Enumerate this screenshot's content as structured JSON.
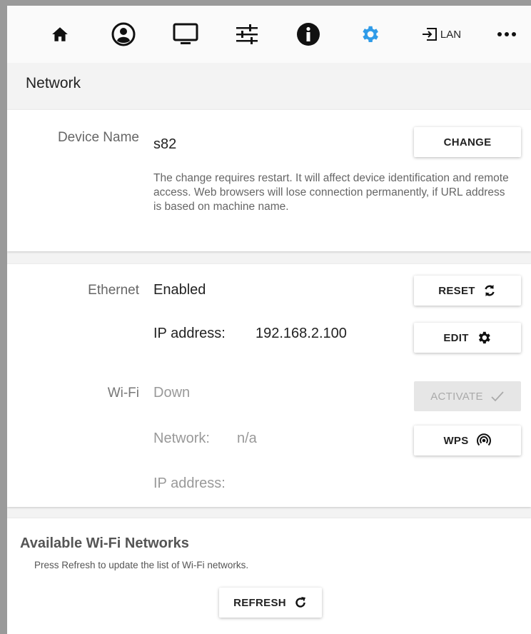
{
  "nav": {
    "items": [
      {
        "icon": "home-icon"
      },
      {
        "icon": "account-icon"
      },
      {
        "icon": "monitor-icon"
      },
      {
        "icon": "sliders-icon"
      },
      {
        "icon": "info-icon"
      },
      {
        "icon": "gear-icon",
        "active": true
      },
      {
        "icon": "input-icon",
        "label": "LAN"
      },
      {
        "icon": "more-icon"
      }
    ],
    "active_color": "#2f9be8"
  },
  "page": {
    "title": "Network"
  },
  "device": {
    "label": "Device Name",
    "value": "s82",
    "change_button": "CHANGE",
    "description": "The change requires restart. It will affect device identification and remote access. Web browsers will lose connection permanently, if URL address is based on machine name."
  },
  "ethernet": {
    "label": "Ethernet",
    "status": "Enabled",
    "reset_button": "RESET",
    "ip_label": "IP address:",
    "ip_value": "192.168.2.100",
    "edit_button": "EDIT"
  },
  "wifi": {
    "label": "Wi-Fi",
    "status": "Down",
    "activate_button": "ACTIVATE",
    "network_label": "Network:",
    "network_value": "n/a",
    "wps_button": "WPS",
    "ip_label": "IP address:"
  },
  "networks": {
    "title": "Available Wi-Fi Networks",
    "subtitle": "Press Refresh to update the list of Wi-Fi networks.",
    "refresh_button": "REFRESH"
  }
}
